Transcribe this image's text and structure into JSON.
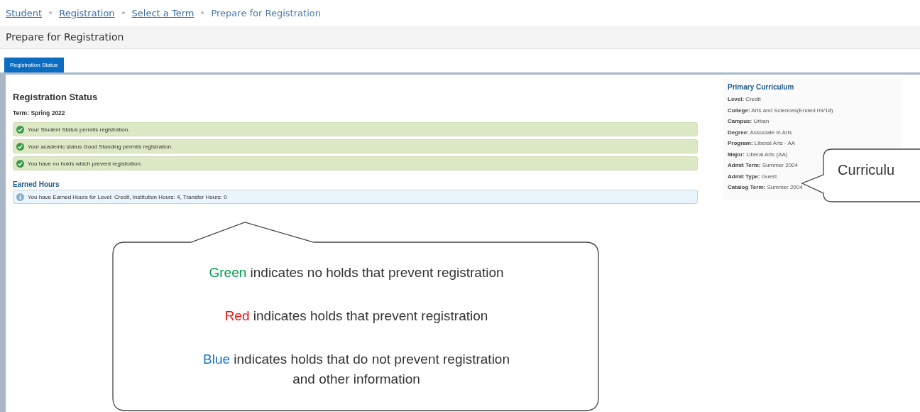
{
  "breadcrumb": [
    {
      "label": "Student",
      "link": true
    },
    {
      "label": "Registration",
      "link": true
    },
    {
      "label": "Select a Term",
      "link": true
    },
    {
      "label": "Prepare for Registration",
      "link": false
    }
  ],
  "page_title": "Prepare for Registration",
  "tabs": [
    {
      "label": "Registration Status",
      "selected": true
    }
  ],
  "status": {
    "title": "Registration Status",
    "term_label": "Term:",
    "term": "Spring 2022",
    "messages": [
      {
        "kind": "success",
        "text": "Your Student Status permits registration."
      },
      {
        "kind": "success",
        "text": "Your academic status Good Standing permits registration."
      },
      {
        "kind": "success",
        "text": "You have no holds which prevent registration."
      }
    ]
  },
  "earned_hours": {
    "title": "Earned Hours",
    "messages": [
      {
        "kind": "info",
        "text": "You have Earned Hours for Level: Credit, Institution Hours: 4, Transfer Hours: 0"
      }
    ]
  },
  "curriculum": {
    "title": "Primary Curriculum",
    "fields": [
      {
        "label": "Level:",
        "value": "Credit"
      },
      {
        "label": "College:",
        "value": "Arts and Sciences(Ended 09/18)"
      },
      {
        "label": "Campus:",
        "value": "Urban"
      },
      {
        "label": "Degree:",
        "value": "Associate in Arts"
      },
      {
        "label": "Program:",
        "value": "Liberal Arts - AA"
      },
      {
        "label": "Major:",
        "value": "Liberal Arts (AA)"
      },
      {
        "label": "Admit Term:",
        "value": "Summer 2004"
      },
      {
        "label": "Admit Type:",
        "value": "Guest"
      },
      {
        "label": "Catalog Term:",
        "value": "Summer 2004"
      }
    ]
  },
  "legend_callout": {
    "lines": [
      {
        "highlight": "Green",
        "color": "#00a04b",
        "rest": " indicates no holds that prevent registration"
      },
      {
        "highlight": "Red",
        "color": "#ee1111",
        "rest": " indicates holds that prevent registration"
      },
      {
        "highlight": "Blue",
        "color": "#1874cd",
        "rest": " indicates holds that do not prevent registration and other information"
      }
    ]
  },
  "curriculum_callout": {
    "text": "Curriculu"
  }
}
